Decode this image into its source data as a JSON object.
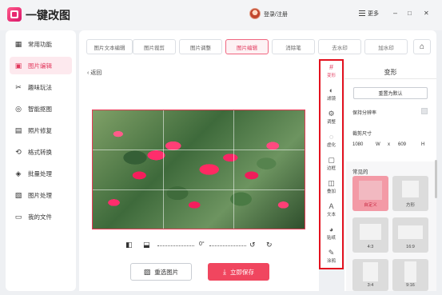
{
  "app": {
    "title": "一键改图",
    "login": "登录/注册",
    "more": "更多",
    "min": "–",
    "max": "□",
    "close": "✕"
  },
  "sidebar": {
    "items": [
      {
        "label": "常用功能",
        "icon": "grid-icon",
        "glyph": "▦"
      },
      {
        "label": "图片编辑",
        "icon": "image-edit-icon",
        "glyph": "▣"
      },
      {
        "label": "趣味玩法",
        "icon": "fun-icon",
        "glyph": "✂"
      },
      {
        "label": "智能抠图",
        "icon": "cutout-icon",
        "glyph": "◎"
      },
      {
        "label": "照片修复",
        "icon": "photo-repair-icon",
        "glyph": "▤"
      },
      {
        "label": "格式转换",
        "icon": "convert-icon",
        "glyph": "⟲"
      },
      {
        "label": "批量处理",
        "icon": "layers-icon",
        "glyph": "◈"
      },
      {
        "label": "图片处理",
        "icon": "image-process-icon",
        "glyph": "▧"
      },
      {
        "label": "我的文件",
        "icon": "file-icon",
        "glyph": "▭"
      }
    ],
    "active_index": 1
  },
  "tabs": [
    {
      "label": "图片文本编辑"
    },
    {
      "label": "图片裁剪"
    },
    {
      "label": "图片调整"
    },
    {
      "label": "图片编辑"
    },
    {
      "label": "消除笔"
    },
    {
      "label": "去水印"
    },
    {
      "label": "加水印"
    }
  ],
  "active_tab": 3,
  "editor": {
    "back": "返回",
    "angle": "0°",
    "reselect": "重选图片",
    "save": "立即保存"
  },
  "tools": [
    {
      "label": "变形",
      "icon": "transform-icon",
      "glyph": "#"
    },
    {
      "label": "滤镜",
      "icon": "filter-icon",
      "glyph": "◐"
    },
    {
      "label": "调整",
      "icon": "adjust-icon",
      "glyph": "⚙"
    },
    {
      "label": "虚化",
      "icon": "blur-icon",
      "glyph": "◌"
    },
    {
      "label": "边框",
      "icon": "border-icon",
      "glyph": "▢"
    },
    {
      "label": "叠加",
      "icon": "overlay-icon",
      "glyph": "◫"
    },
    {
      "label": "文本",
      "icon": "text-icon",
      "glyph": "A"
    },
    {
      "label": "贴纸",
      "icon": "sticker-icon",
      "glyph": "◕"
    },
    {
      "label": "涂鸦",
      "icon": "doodle-icon",
      "glyph": "✎"
    }
  ],
  "panel": {
    "title": "变形",
    "reset": "重置为默认",
    "keep_resolution": "保持分辨率",
    "crop_size": "裁剪尺寸",
    "width": "1080",
    "w_label": "W",
    "x_label": "x",
    "height": "609",
    "h_label": "H",
    "common": "常见的",
    "presets": [
      "自定义",
      "方形",
      "4:3",
      "16:9",
      "3:4",
      "9:16"
    ]
  },
  "colors": {
    "accent": "#e23a5e",
    "save_button": "#f0465f",
    "highlight_border": "#e3121f"
  }
}
